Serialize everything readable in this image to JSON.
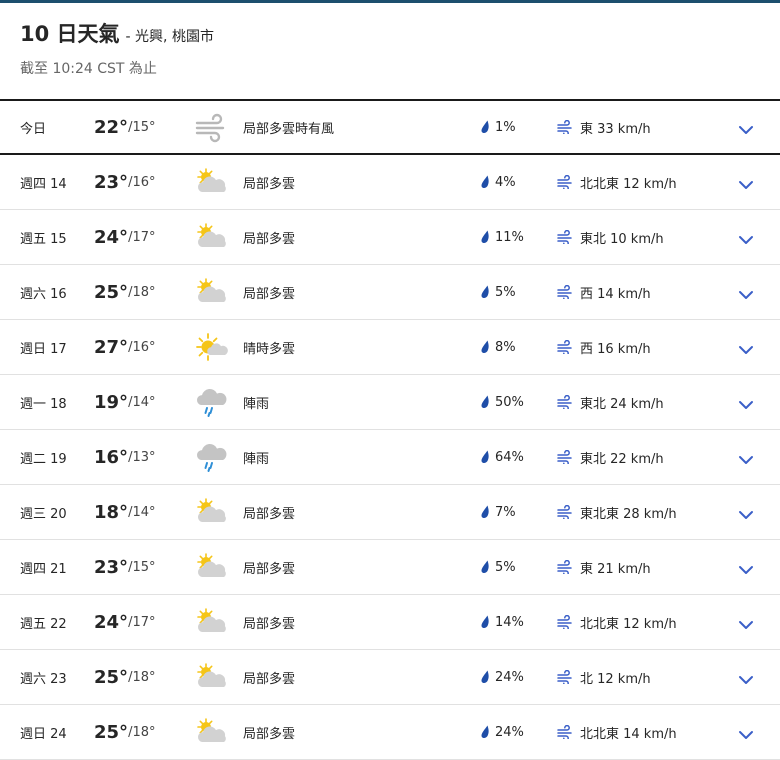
{
  "header": {
    "title": "10 日天氣",
    "location": "- 光興, 桃園市",
    "updated": "截至 10:24 CST 為止"
  },
  "colors": {
    "accent_bar": "#1d4f6e",
    "drop": "#1f4ea8",
    "wind": "#3a5fc8",
    "chevron": "#3a5fc8",
    "sun": "#f5c518",
    "cloud": "#cfcfcf",
    "rain": "#2f8fd6"
  },
  "days": [
    {
      "day": "今日",
      "hi": "22°",
      "lo": "/15°",
      "icon": "wind-icon",
      "cond": "局部多雲時有風",
      "precip": "1%",
      "wind": "東 33 km/h"
    },
    {
      "day": "週四 14",
      "hi": "23°",
      "lo": "/16°",
      "icon": "partly-cloudy-icon",
      "cond": "局部多雲",
      "precip": "4%",
      "wind": "北北東 12 km/h"
    },
    {
      "day": "週五 15",
      "hi": "24°",
      "lo": "/17°",
      "icon": "partly-cloudy-icon",
      "cond": "局部多雲",
      "precip": "11%",
      "wind": "東北 10 km/h"
    },
    {
      "day": "週六 16",
      "hi": "25°",
      "lo": "/18°",
      "icon": "partly-cloudy-icon",
      "cond": "局部多雲",
      "precip": "5%",
      "wind": "西 14 km/h"
    },
    {
      "day": "週日 17",
      "hi": "27°",
      "lo": "/16°",
      "icon": "mostly-sunny-icon",
      "cond": "晴時多雲",
      "precip": "8%",
      "wind": "西 16 km/h"
    },
    {
      "day": "週一 18",
      "hi": "19°",
      "lo": "/14°",
      "icon": "showers-icon",
      "cond": "陣雨",
      "precip": "50%",
      "wind": "東北 24 km/h"
    },
    {
      "day": "週二 19",
      "hi": "16°",
      "lo": "/13°",
      "icon": "showers-icon",
      "cond": "陣雨",
      "precip": "64%",
      "wind": "東北 22 km/h"
    },
    {
      "day": "週三 20",
      "hi": "18°",
      "lo": "/14°",
      "icon": "partly-cloudy-icon",
      "cond": "局部多雲",
      "precip": "7%",
      "wind": "東北東 28 km/h"
    },
    {
      "day": "週四 21",
      "hi": "23°",
      "lo": "/15°",
      "icon": "partly-cloudy-icon",
      "cond": "局部多雲",
      "precip": "5%",
      "wind": "東 21 km/h"
    },
    {
      "day": "週五 22",
      "hi": "24°",
      "lo": "/17°",
      "icon": "partly-cloudy-icon",
      "cond": "局部多雲",
      "precip": "14%",
      "wind": "北北東 12 km/h"
    },
    {
      "day": "週六 23",
      "hi": "25°",
      "lo": "/18°",
      "icon": "partly-cloudy-icon",
      "cond": "局部多雲",
      "precip": "24%",
      "wind": "北 12 km/h"
    },
    {
      "day": "週日 24",
      "hi": "25°",
      "lo": "/18°",
      "icon": "partly-cloudy-icon",
      "cond": "局部多雲",
      "precip": "24%",
      "wind": "北北東 14 km/h"
    }
  ]
}
